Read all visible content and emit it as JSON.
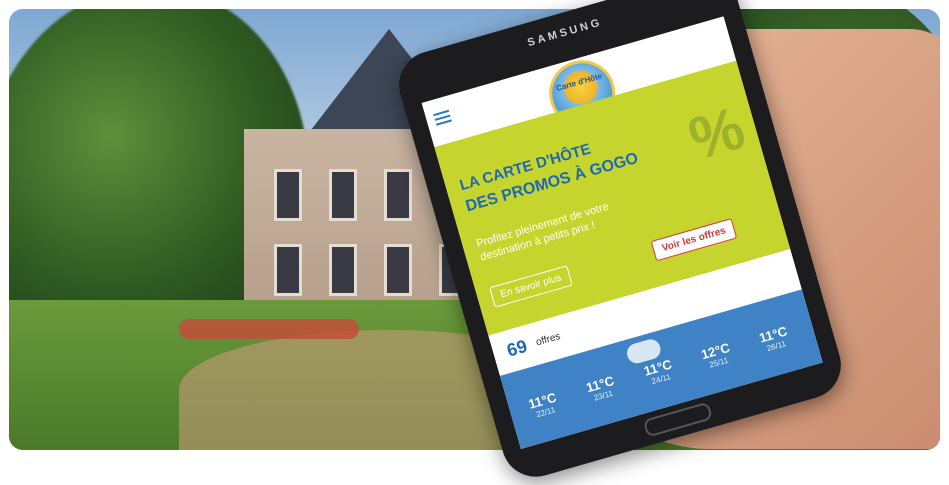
{
  "phone": {
    "brand": "SAMSUNG",
    "app": {
      "logo_text": "Carte d'Hôte",
      "hero": {
        "title_line1": "LA CARTE D'HÔTE",
        "title_line2": "DES PROMOS À GOGO",
        "percent_symbol": "%",
        "description": "Profitez pleinement de votre destination à petits prix !",
        "primary_button": "En savoir plus",
        "secondary_button": "Voir les offres"
      },
      "offers": {
        "count": "69",
        "label": "offres"
      },
      "weather": [
        {
          "temp": "11°C",
          "date": "22/11"
        },
        {
          "temp": "11°C",
          "date": "23/11"
        },
        {
          "temp": "11°C",
          "date": "24/11"
        },
        {
          "temp": "12°C",
          "date": "25/11"
        },
        {
          "temp": "11°C",
          "date": "26/11"
        }
      ]
    }
  },
  "colors": {
    "app_green": "#c6d52e",
    "app_blue": "#1e68b4",
    "weather_blue": "#3f83c6",
    "button_red": "#d23a3a"
  }
}
